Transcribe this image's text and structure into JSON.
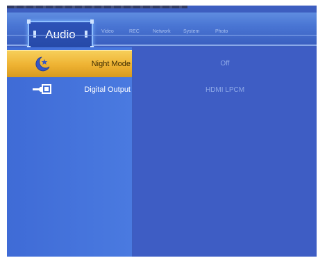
{
  "header": {
    "active_tab": "Audio",
    "tabs": [
      "Video",
      "REC",
      "Network",
      "System",
      "Photo"
    ]
  },
  "settings": [
    {
      "label": "Night Mode",
      "value": "Off",
      "icon": "moon-star-icon",
      "selected": true
    },
    {
      "label": "Digital Output",
      "value": "HDMI LPCM",
      "icon": "hand-audio-output-icon",
      "selected": false
    }
  ],
  "colors": {
    "background": "#3d5ec0",
    "selected_row": "#eeb232",
    "header": "#4a76d4",
    "value_text": "#8faae8"
  }
}
